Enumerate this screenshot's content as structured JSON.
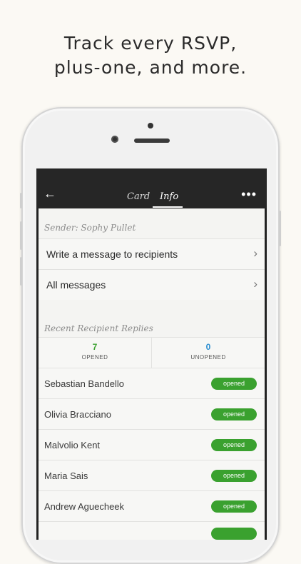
{
  "headline": [
    "Track every RSVP,",
    "plus-one, and more."
  ],
  "colors": {
    "accent_green": "#3aa12f",
    "opened_count": "#3aa12f",
    "unopened_count": "#2b8ed1",
    "nav_bg": "#262626"
  },
  "nav": {
    "back_icon": "←",
    "tabs": [
      {
        "label": "Card"
      },
      {
        "label": "Info"
      }
    ],
    "more_icon": "•••"
  },
  "sender": {
    "label": "Sender: Sophy Pullet"
  },
  "actions": [
    {
      "label": "Write a message to recipients",
      "chevron": "›"
    },
    {
      "label": "All messages",
      "chevron": "›"
    }
  ],
  "replies": {
    "label": "Recent Recipient Replies"
  },
  "stats": {
    "opened": {
      "count": "7",
      "label": "OPENED"
    },
    "unopened": {
      "count": "0",
      "label": "UNOPENED"
    }
  },
  "recipients": [
    {
      "name": "Sebastian Bandello",
      "status": "opened"
    },
    {
      "name": "Olivia Bracciano",
      "status": "opened"
    },
    {
      "name": "Malvolio Kent",
      "status": "opened"
    },
    {
      "name": "Maria Sais",
      "status": "opened"
    },
    {
      "name": "Andrew Aguecheek",
      "status": "opened"
    }
  ]
}
